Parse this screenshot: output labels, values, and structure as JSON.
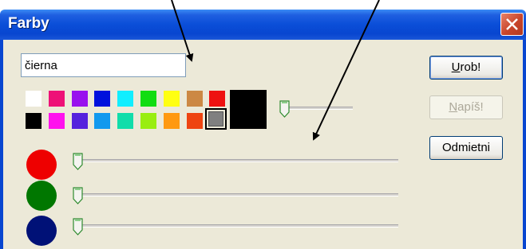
{
  "window": {
    "title": "Farby"
  },
  "color_name_input": {
    "value": "čierna"
  },
  "palette": {
    "row1": [
      "#ffffff",
      "#ee1177",
      "#9911ee",
      "#0011dd",
      "#11eeff",
      "#11dd11",
      "#ffff11",
      "#cc8844",
      "#ee1111"
    ],
    "row2": [
      "#000000",
      "#ff11ee",
      "#5522dd",
      "#1199ee",
      "#11ddaa",
      "#99ee11",
      "#ff9911",
      "#ee4411"
    ],
    "selected_color": "#808080",
    "preview_color": "#000000"
  },
  "channels": [
    {
      "name": "red",
      "color": "#ee0000",
      "value": 0
    },
    {
      "name": "green",
      "color": "#007700",
      "value": 0
    },
    {
      "name": "blue",
      "color": "#001177",
      "value": 0
    }
  ],
  "brightness_slider": {
    "value": 0
  },
  "buttons": {
    "ok": {
      "mnemonic": "U",
      "rest": "rob!"
    },
    "write": {
      "mnemonic": "N",
      "rest": "apíš!"
    },
    "cancel": {
      "label": "Odmietni"
    }
  },
  "colors": {
    "window_bg": "#ece9d8",
    "titlebar": "#0846d0"
  }
}
